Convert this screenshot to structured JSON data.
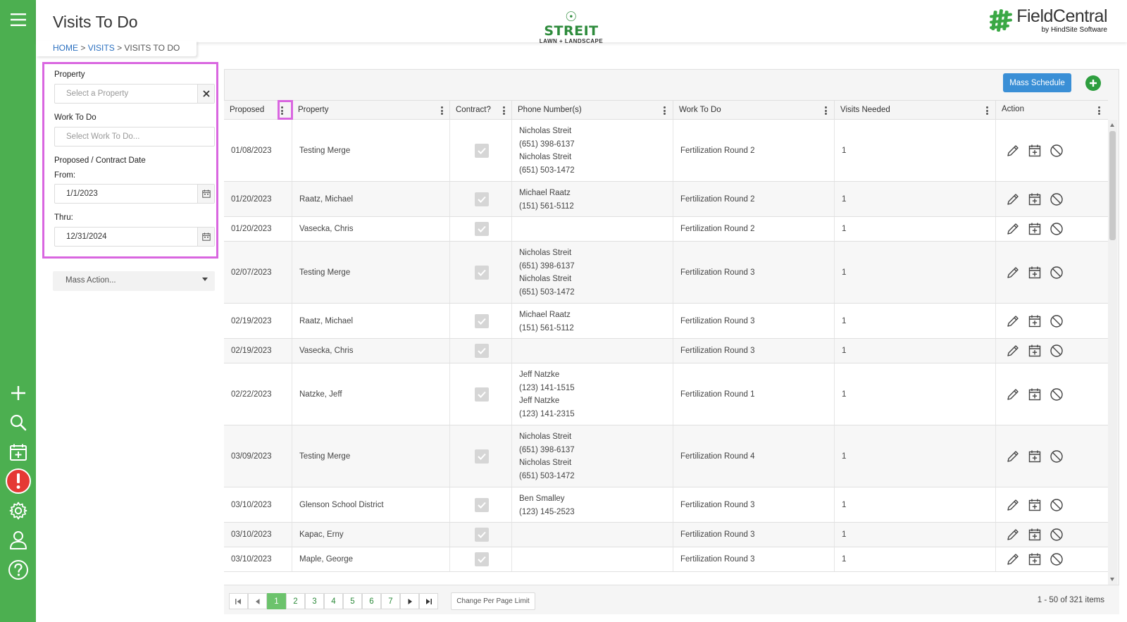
{
  "page": {
    "title": "Visits To Do"
  },
  "branding": {
    "company_name": "STREIT",
    "company_tagline": "LAWN + LANDSCAPE",
    "app_name": "FieldCentral",
    "app_byline": "by HindSite Software"
  },
  "breadcrumb": {
    "home": "HOME",
    "section": "VISITS",
    "current": "VISITS TO DO",
    "separator": ">"
  },
  "sidebar": {
    "icons": [
      "menu-icon",
      "plus-icon",
      "search-icon",
      "calendar-add-icon",
      "alert-icon",
      "gear-icon",
      "user-icon",
      "help-icon"
    ],
    "colors": {
      "background": "#4caf50",
      "alert": "#e53935"
    }
  },
  "filters": {
    "property_label": "Property",
    "property_placeholder": "Select a Property",
    "work_label": "Work To Do",
    "work_placeholder": "Select Work To Do...",
    "date_label": "Proposed / Contract Date",
    "from_label": "From:",
    "from_value": "1/1/2023",
    "thru_label": "Thru:",
    "thru_value": "12/31/2024"
  },
  "mass_action": {
    "label": "Mass Action..."
  },
  "toolbar": {
    "mass_schedule_label": "Mass Schedule",
    "accent": "#3a8fd6",
    "add_color": "#2e9e3f"
  },
  "grid": {
    "columns": [
      "Proposed",
      "Property",
      "Contract?",
      "Phone Number(s)",
      "Work To Do",
      "Visits Needed",
      "Action"
    ],
    "rows": [
      {
        "proposed": "01/08/2023",
        "property": "Testing Merge",
        "contract": true,
        "phones": [
          "Nicholas Streit",
          "(651) 398-6137",
          "Nicholas Streit",
          "(651) 503-1472"
        ],
        "work": "Fertilization Round 2",
        "visits": "1"
      },
      {
        "proposed": "01/20/2023",
        "property": "Raatz, Michael",
        "contract": true,
        "phones": [
          "Michael Raatz",
          "(151) 561-5112"
        ],
        "work": "Fertilization Round 2",
        "visits": "1"
      },
      {
        "proposed": "01/20/2023",
        "property": "Vasecka, Chris",
        "contract": true,
        "phones": [],
        "work": "Fertilization Round 2",
        "visits": "1"
      },
      {
        "proposed": "02/07/2023",
        "property": "Testing Merge",
        "contract": true,
        "phones": [
          "Nicholas Streit",
          "(651) 398-6137",
          "Nicholas Streit",
          "(651) 503-1472"
        ],
        "work": "Fertilization Round 3",
        "visits": "1"
      },
      {
        "proposed": "02/19/2023",
        "property": "Raatz, Michael",
        "contract": true,
        "phones": [
          "Michael Raatz",
          "(151) 561-5112"
        ],
        "work": "Fertilization Round 3",
        "visits": "1"
      },
      {
        "proposed": "02/19/2023",
        "property": "Vasecka, Chris",
        "contract": true,
        "phones": [],
        "work": "Fertilization Round 3",
        "visits": "1"
      },
      {
        "proposed": "02/22/2023",
        "property": "Natzke, Jeff",
        "contract": true,
        "phones": [
          "Jeff Natzke",
          "(123) 141-1515",
          "Jeff Natzke",
          "(123) 141-2315"
        ],
        "work": "Fertilization Round 1",
        "visits": "1"
      },
      {
        "proposed": "03/09/2023",
        "property": "Testing Merge",
        "contract": true,
        "phones": [
          "Nicholas Streit",
          "(651) 398-6137",
          "Nicholas Streit",
          "(651) 503-1472"
        ],
        "work": "Fertilization Round 4",
        "visits": "1"
      },
      {
        "proposed": "03/10/2023",
        "property": "Glenson School District",
        "contract": true,
        "phones": [
          "Ben Smalley",
          "(123) 145-2523"
        ],
        "work": "Fertilization Round 3",
        "visits": "1"
      },
      {
        "proposed": "03/10/2023",
        "property": "Kapac, Erny",
        "contract": true,
        "phones": [],
        "work": "Fertilization Round 3",
        "visits": "1"
      },
      {
        "proposed": "03/10/2023",
        "property": "Maple, George",
        "contract": true,
        "phones": [],
        "work": "Fertilization Round 3",
        "visits": "1"
      }
    ],
    "row_actions": [
      "edit-icon",
      "schedule-icon",
      "cancel-icon"
    ]
  },
  "pager": {
    "pages": [
      "1",
      "2",
      "3",
      "4",
      "5",
      "6",
      "7"
    ],
    "current_page": "1",
    "per_page_label": "Change Per Page Limit",
    "info": "1 - 50 of 321 items"
  },
  "highlight_color": "#d966e0"
}
